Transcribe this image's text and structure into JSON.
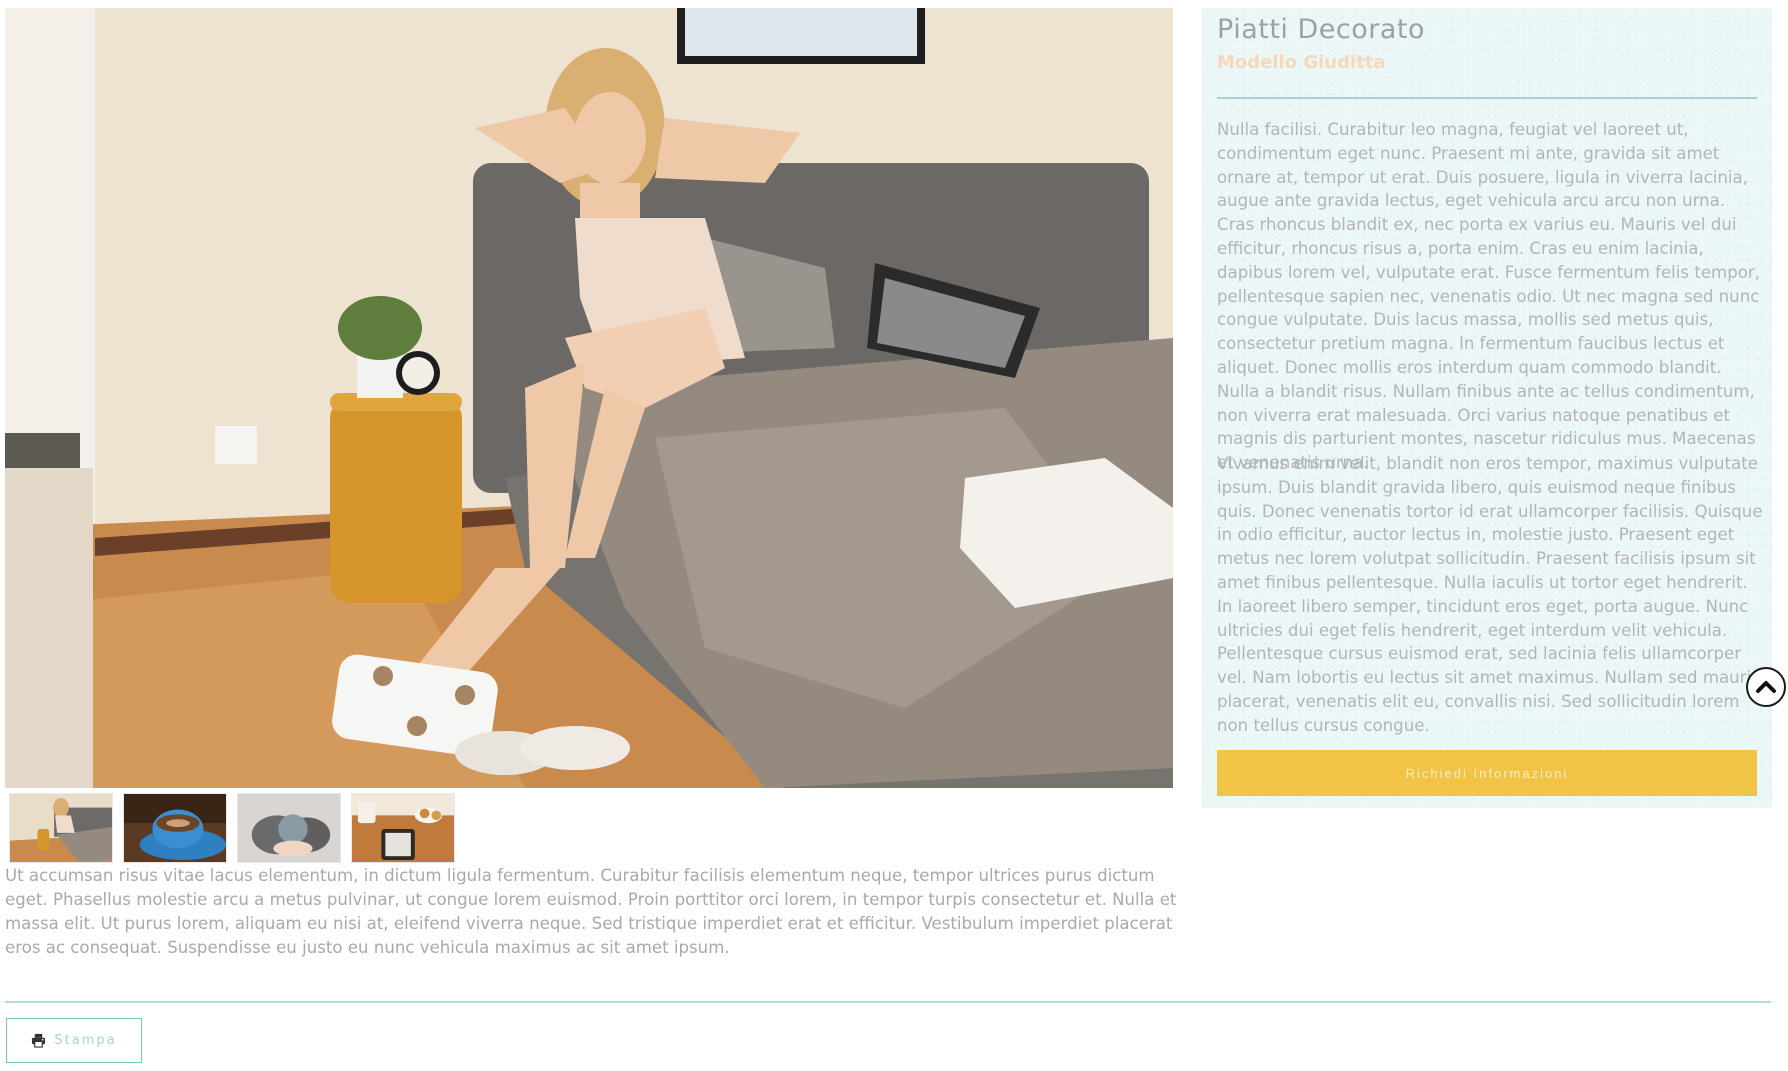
{
  "product": {
    "title": "Piatti Decorato",
    "subtitle": "Modello Giuditta",
    "paragraph_1": "Nulla facilisi. Curabitur leo magna, feugiat vel laoreet ut, condimentum eget nunc. Praesent mi ante, gravida sit amet ornare at, tempor ut erat. Duis posuere, ligula in viverra lacinia, augue ante gravida lectus, eget vehicula arcu arcu non urna. Cras rhoncus blandit ex, nec porta ex varius eu. Mauris vel dui efficitur, rhoncus risus a, porta enim. Cras eu enim lacinia, dapibus lorem vel, vulputate erat. Fusce fermentum felis tempor, pellentesque sapien nec, venenatis odio. Ut nec magna sed nunc congue vulputate. Duis lacus massa, mollis sed metus quis, consectetur pretium magna. In fermentum faucibus lectus et aliquet. Donec mollis eros interdum quam commodo blandit. Nulla a blandit risus. Nullam finibus ante ac tellus condimentum, non viverra erat malesuada. Orci varius natoque penatibus et magnis dis parturient montes, nascetur ridiculus mus. Maecenas et venenatis urna.",
    "paragraph_2": "Vivamus enim velit, blandit non eros tempor, maximus vulputate ipsum. Duis blandit gravida libero, quis euismod neque finibus quis. Donec venenatis tortor id erat ullamcorper facilisis. Quisque in odio efficitur, auctor lectus in, molestie justo. Praesent eget metus nec lorem volutpat sollicitudin. Praesent facilisis ipsum sit amet finibus pellentesque. Nulla iaculis ut tortor eget hendrerit. In laoreet libero semper, tincidunt eros eget, porta augue. Nunc ultricies dui eget felis hendrerit, eget interdum velit vehicula. Pellentesque cursus euismod erat, sed lacinia felis ullamcorper vel. Nam lobortis eu lectus sit amet maximus. Nullam sed mauris placerat, venenatis elit eu, convallis nisi. Sed sollicitudin lorem non tellus cursus congue.",
    "cta_label": "Richiedi Informazioni"
  },
  "gallery": {
    "main_image_icon": "bedroom-photo",
    "thumbnails": [
      {
        "icon": "bedroom-photo"
      },
      {
        "icon": "coffee-cup-photo"
      },
      {
        "icon": "hands-ball-photo"
      },
      {
        "icon": "coffee-tablet-photo"
      }
    ]
  },
  "description": "Ut accumsan risus vitae lacus elementum, in dictum ligula fermentum. Curabitur facilisis elementum neque, tempor ultrices purus dictum eget. Phasellus molestie arcu a metus pulvinar, ut congue lorem euismod. Proin porttitor orci lorem, in tempor turpis consectetur et. Nulla et massa elit. Ut purus lorem, aliquam eu nisi at, eleifend viverra neque. Sed tristique imperdiet erat et efficitur. Vestibulum imperdiet placerat eros ac consequat. Suspendisse eu justo eu nunc vehicula maximus ac sit amet ipsum.",
  "actions": {
    "print_label": "Stampa",
    "print_icon": "printer-icon",
    "scroll_top_icon": "chevron-up-icon"
  },
  "colors": {
    "accent": "#79c6c4",
    "cta": "#f1c347",
    "subtitle": "#f6d7b8",
    "panel_bg": "#ebf6f6"
  }
}
